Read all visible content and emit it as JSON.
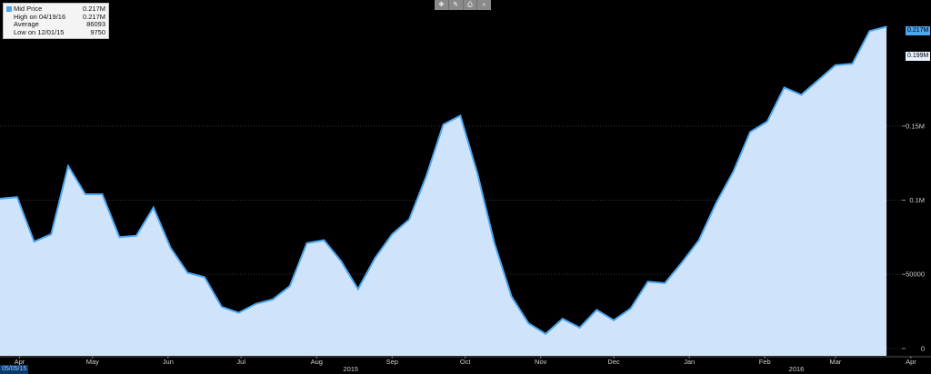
{
  "toolbar": {
    "buttons": [
      {
        "name": "move-icon",
        "glyph": "✥"
      },
      {
        "name": "pencil-icon",
        "glyph": "✎"
      },
      {
        "name": "camera-icon",
        "glyph": "⎙"
      },
      {
        "name": "zoom-icon",
        "glyph": "⌕"
      }
    ]
  },
  "legend": {
    "series_label": "Mid Price",
    "series_value": "0.217M",
    "high_label": "High on 04/19/16",
    "high_value": "0.217M",
    "avg_label": "Average",
    "avg_value": "86093",
    "low_label": "Low on 12/01/15",
    "low_value": "9750"
  },
  "tags": {
    "last_value": "0.217M",
    "other_value": "0.199M"
  },
  "start_date": "05/05/15",
  "chart_data": {
    "type": "area",
    "title": "",
    "xlabel": "",
    "ylabel": "",
    "ylim": [
      -5000,
      235000
    ],
    "y_ticks": [
      0,
      50000,
      100000,
      150000
    ],
    "y_tick_labels": [
      "0",
      "50000",
      "0.1M",
      "0.15M"
    ],
    "x_month_labels": [
      {
        "label": "Apr",
        "date": "2015-04-15"
      },
      {
        "label": "May",
        "date": "2015-05-15"
      },
      {
        "label": "Jun",
        "date": "2015-06-15"
      },
      {
        "label": "Jul",
        "date": "2015-07-15"
      },
      {
        "label": "Aug",
        "date": "2015-08-15"
      },
      {
        "label": "Sep",
        "date": "2015-09-15"
      },
      {
        "label": "Oct",
        "date": "2015-10-15"
      },
      {
        "label": "Nov",
        "date": "2015-11-15"
      },
      {
        "label": "Dec",
        "date": "2015-12-15"
      },
      {
        "label": "Jan",
        "date": "2016-01-15"
      },
      {
        "label": "Feb",
        "date": "2016-02-15"
      },
      {
        "label": "Mar",
        "date": "2016-03-15"
      },
      {
        "label": "Apr",
        "date": "2016-04-15"
      }
    ],
    "x_year_labels": [
      {
        "label": "2015",
        "date": "2015-08-29"
      },
      {
        "label": "2016",
        "date": "2016-02-28"
      }
    ],
    "grid": true,
    "series": [
      {
        "name": "Mid Price",
        "color": "#4da6f0",
        "fill": "#cfe4fb",
        "points": [
          [
            "2015-04-07",
            101000
          ],
          [
            "2015-04-14",
            102000
          ],
          [
            "2015-04-21",
            72000
          ],
          [
            "2015-04-28",
            77000
          ],
          [
            "2015-05-05",
            123000
          ],
          [
            "2015-05-12",
            104000
          ],
          [
            "2015-05-19",
            104000
          ],
          [
            "2015-05-26",
            75000
          ],
          [
            "2015-06-02",
            76000
          ],
          [
            "2015-06-09",
            95000
          ],
          [
            "2015-06-16",
            68000
          ],
          [
            "2015-06-23",
            51000
          ],
          [
            "2015-06-30",
            48000
          ],
          [
            "2015-07-07",
            28000
          ],
          [
            "2015-07-14",
            24000
          ],
          [
            "2015-07-21",
            30000
          ],
          [
            "2015-07-28",
            33000
          ],
          [
            "2015-08-04",
            42000
          ],
          [
            "2015-08-11",
            71000
          ],
          [
            "2015-08-18",
            73000
          ],
          [
            "2015-08-25",
            59000
          ],
          [
            "2015-09-01",
            40000
          ],
          [
            "2015-09-08",
            61000
          ],
          [
            "2015-09-15",
            77000
          ],
          [
            "2015-09-22",
            87000
          ],
          [
            "2015-09-29",
            116000
          ],
          [
            "2015-10-06",
            151000
          ],
          [
            "2015-10-13",
            157000
          ],
          [
            "2015-10-20",
            118000
          ],
          [
            "2015-10-27",
            71000
          ],
          [
            "2015-11-03",
            35000
          ],
          [
            "2015-11-10",
            17000
          ],
          [
            "2015-11-17",
            9750
          ],
          [
            "2015-11-24",
            20000
          ],
          [
            "2015-12-01",
            14000
          ],
          [
            "2015-12-08",
            26000
          ],
          [
            "2015-12-15",
            19000
          ],
          [
            "2015-12-22",
            27000
          ],
          [
            "2015-12-29",
            45000
          ],
          [
            "2016-01-05",
            44000
          ],
          [
            "2016-01-12",
            58000
          ],
          [
            "2016-01-19",
            73000
          ],
          [
            "2016-01-26",
            98000
          ],
          [
            "2016-02-02",
            119000
          ],
          [
            "2016-02-09",
            146000
          ],
          [
            "2016-02-16",
            153000
          ],
          [
            "2016-02-23",
            176000
          ],
          [
            "2016-03-01",
            171000
          ],
          [
            "2016-03-08",
            181000
          ],
          [
            "2016-03-15",
            191000
          ],
          [
            "2016-03-22",
            192000
          ],
          [
            "2016-03-29",
            214000
          ],
          [
            "2016-04-05",
            217000
          ]
        ]
      }
    ]
  }
}
